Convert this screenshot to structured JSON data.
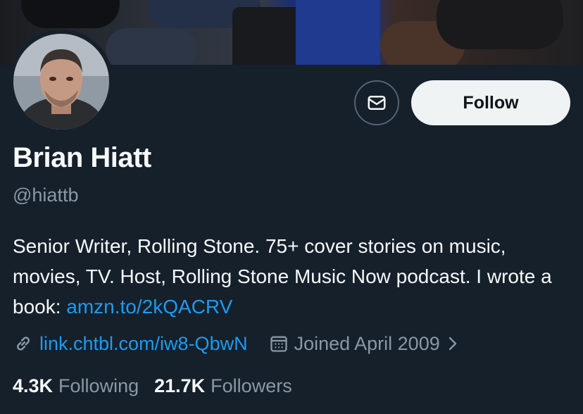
{
  "profile": {
    "name": "Brian Hiatt",
    "handle": "@hiattb",
    "bio_text": "Senior Writer, Rolling Stone. 75+ cover stories on music, movies, TV. Host, Rolling Stone Music Now podcast. I wrote a book: ",
    "bio_link": "amzn.to/2kQACRV",
    "website": "link.chtbl.com/iw8-QbwN",
    "joined": "Joined April 2009"
  },
  "actions": {
    "follow_label": "Follow",
    "message_icon": "envelope-icon"
  },
  "stats": {
    "following_count": "4.3K",
    "following_label": "Following",
    "followers_count": "21.7K",
    "followers_label": "Followers"
  },
  "icons": {
    "link": "link-icon",
    "calendar": "calendar-icon",
    "chevron": "chevron-right-icon"
  },
  "colors": {
    "background": "#15202b",
    "link": "#1d9bf0",
    "secondary_text": "#8b98a5",
    "follow_button_bg": "#eff3f4"
  }
}
